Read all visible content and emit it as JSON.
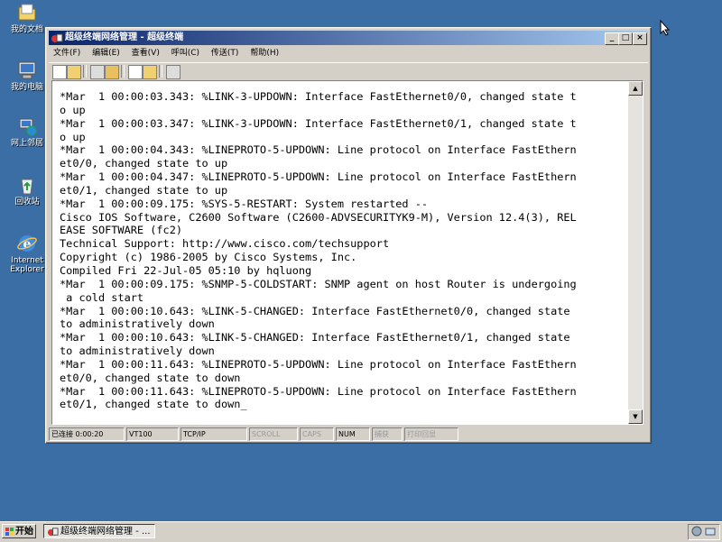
{
  "desktop": {
    "icons": [
      {
        "label": "我的文档",
        "icon": "my-documents-icon"
      },
      {
        "label": "我的电脑",
        "icon": "my-computer-icon"
      },
      {
        "label": "网上邻居",
        "icon": "network-places-icon"
      },
      {
        "label": "回收站",
        "icon": "recycle-bin-icon"
      },
      {
        "label": "Internet Explorer",
        "icon": "internet-explorer-icon"
      }
    ]
  },
  "window": {
    "title": "超级终端网络管理 - 超级终端",
    "controls": {
      "minimize": "_",
      "maximize": "□",
      "close": "×"
    },
    "menu": [
      "文件(F)",
      "编辑(E)",
      "查看(V)",
      "呼叫(C)",
      "传送(T)",
      "帮助(H)"
    ],
    "toolbar_icons": [
      "new-icon",
      "open-icon",
      "connect-icon",
      "disconnect-icon",
      "send-icon",
      "receive-icon",
      "properties-icon"
    ],
    "terminal_text": "*Mar  1 00:00:03.343: %LINK-3-UPDOWN: Interface FastEthernet0/0, changed state t\no up\n*Mar  1 00:00:03.347: %LINK-3-UPDOWN: Interface FastEthernet0/1, changed state t\no up\n*Mar  1 00:00:04.343: %LINEPROTO-5-UPDOWN: Line protocol on Interface FastEthern\net0/0, changed state to up\n*Mar  1 00:00:04.347: %LINEPROTO-5-UPDOWN: Line protocol on Interface FastEthern\net0/1, changed state to up\n*Mar  1 00:00:09.175: %SYS-5-RESTART: System restarted --\nCisco IOS Software, C2600 Software (C2600-ADVSECURITYK9-M), Version 12.4(3), REL\nEASE SOFTWARE (fc2)\nTechnical Support: http://www.cisco.com/techsupport\nCopyright (c) 1986-2005 by Cisco Systems, Inc.\nCompiled Fri 22-Jul-05 05:10 by hqluong\n*Mar  1 00:00:09.175: %SNMP-5-COLDSTART: SNMP agent on host Router is undergoing\n a cold start\n*Mar  1 00:00:10.643: %LINK-5-CHANGED: Interface FastEthernet0/0, changed state\nto administratively down\n*Mar  1 00:00:10.643: %LINK-5-CHANGED: Interface FastEthernet0/1, changed state\nto administratively down\n*Mar  1 00:00:11.643: %LINEPROTO-5-UPDOWN: Line protocol on Interface FastEthern\net0/0, changed state to down\n*Mar  1 00:00:11.643: %LINEPROTO-5-UPDOWN: Line protocol on Interface FastEthern\net0/1, changed state to down_",
    "status": {
      "connected": "已连接 0:00:20",
      "emulation": "VT100",
      "protocol": "TCP/IP",
      "scroll": "SCROLL",
      "caps": "CAPS",
      "num": "NUM",
      "capture": "捕获",
      "print_echo": "打印回显"
    }
  },
  "taskbar": {
    "start_label": "开始",
    "task_label": "超级终端网络管理 - ..."
  },
  "colors": {
    "desktop": "#3a6ea5",
    "title_active": "#0a246a",
    "chrome": "#d4d0c8"
  }
}
